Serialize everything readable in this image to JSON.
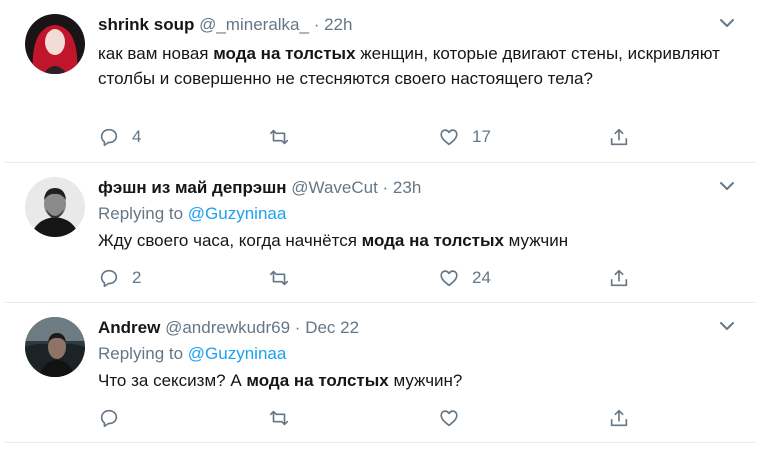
{
  "tweets": [
    {
      "name": "shrink soup",
      "handle": "@_mineralka_",
      "time": "22h",
      "text_before": "как вам новая ",
      "text_bold": "мода на толстых",
      "text_after": " женщин, которые двигают стены, искривляют столбы и совершенно не стесняются своего настоящего тела?",
      "replies": "4",
      "retweets": "",
      "likes": "17"
    },
    {
      "name": "фэшн из май депрэшн",
      "handle": "@WaveCut",
      "time": "23h",
      "replying_to_label": "Replying to ",
      "replying_to": "@Guzyninaa",
      "text_before": "Жду своего часа, когда начнётся ",
      "text_bold": "мода на толстых",
      "text_after": " мужчин",
      "replies": "2",
      "retweets": "",
      "likes": "24"
    },
    {
      "name": "Andrew",
      "handle": "@andrewkudr69",
      "time": "Dec 22",
      "replying_to_label": "Replying to ",
      "replying_to": "@Guzyninaa",
      "text_before": "Что за сексизм? А ",
      "text_bold": "мода на толстых",
      "text_after": " мужчин?",
      "replies": "",
      "retweets": "",
      "likes": ""
    }
  ],
  "separator": " · ",
  "colors": {
    "text": "#14171a",
    "secondary": "#657786",
    "link": "#1da1f2",
    "divider": "#e6ecf0"
  },
  "icons": [
    "reply-icon",
    "retweet-icon",
    "like-icon",
    "share-icon",
    "chevron-down-icon"
  ]
}
